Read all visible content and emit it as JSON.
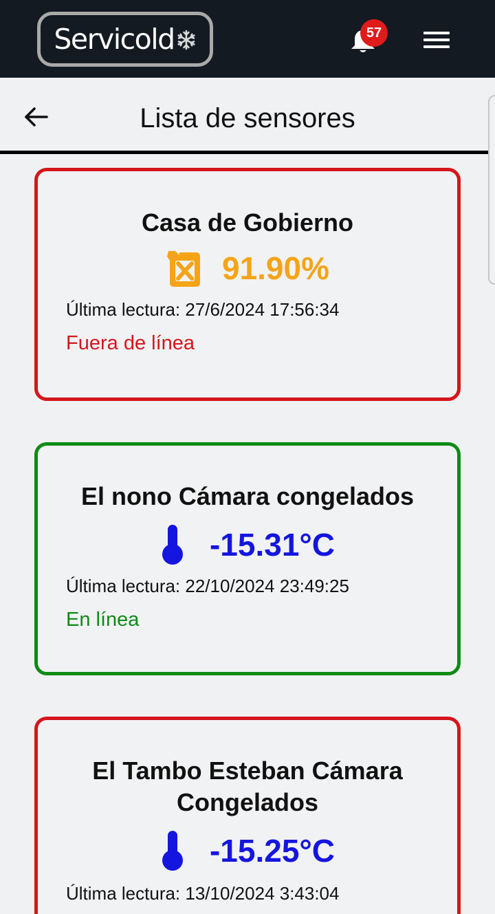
{
  "header": {
    "logo_text": "Servicold",
    "notifications_count": "57"
  },
  "subheader": {
    "title": "Lista de sensores"
  },
  "colors": {
    "offline": "#d4161b",
    "online": "#0f8a16",
    "fuel": "#f5a417",
    "temperature": "#1515e0"
  },
  "sensors": [
    {
      "name": "Casa de Gobierno",
      "icon": "fuel-can-icon",
      "value": "91.90%",
      "last_reading": "Última lectura: 27/6/2024 17:56:34",
      "status": "Fuera de línea"
    },
    {
      "name": "El nono Cámara congelados",
      "icon": "thermometer-icon",
      "value": "-15.31°C",
      "last_reading": "Última lectura: 22/10/2024 23:49:25",
      "status": "En línea"
    },
    {
      "name": "El Tambo Esteban Cámara Congelados",
      "icon": "thermometer-icon",
      "value": "-15.25°C",
      "last_reading": "Última lectura: 13/10/2024 3:43:04"
    }
  ]
}
